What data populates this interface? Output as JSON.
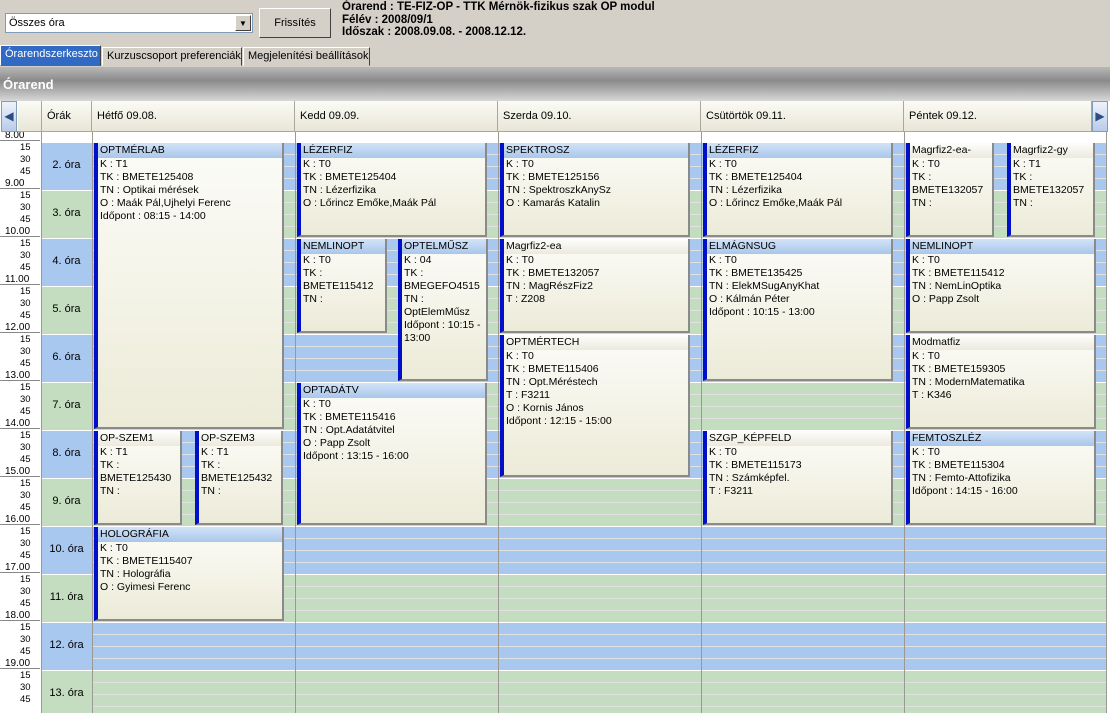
{
  "top": {
    "combo_value": "Összes óra",
    "refresh_label": "Frissítés",
    "orarend_line": "Órarend : TE-FIZ-OP - TTK Mérnök-fizikus szak OP modul",
    "felev_line": "Félév : 2008/09/1",
    "idoszak_line": "Időszak : 2008.09.08. - 2008.12.12."
  },
  "tabs": [
    "Órarendszerkeszto",
    "Kurzuscsoport preferenciák",
    "Megjelenítési beállítások"
  ],
  "panel_title": "Órarend",
  "header": {
    "prev_icon": "◀",
    "next_icon": "▶",
    "hours_label": "Órák",
    "days": [
      "Hétfő  09.08.",
      "Kedd  09.09.",
      "Szerda  09.10.",
      "Csütörtök  09.11.",
      "Péntek  09.12."
    ]
  },
  "hours": [
    "8.00",
    "9.00",
    "10.00",
    "11.00",
    "12.00",
    "13.00",
    "14.00",
    "15.00",
    "16.00",
    "17.00",
    "18.00",
    "19.00"
  ],
  "quarters": [
    "15",
    "30",
    "45"
  ],
  "periods": [
    "2. óra",
    "3. óra",
    "4. óra",
    "5. óra",
    "6. óra",
    "7. óra",
    "8. óra",
    "9. óra",
    "10. óra",
    "11. óra",
    "12. óra",
    "13. óra"
  ],
  "colors": {
    "blue_band": "#a8c8f0",
    "green_band": "#c4dcc0",
    "event_bar": "#0010c8"
  },
  "events": [
    {
      "title": "OPTMÉRLAB",
      "lines": [
        "K : T1",
        "TK : BMETE125408",
        "TN : Optikai mérések",
        "O : Maák Pál,Ujhelyi Ferenc",
        "Időpont : 08:15 - 14:00"
      ]
    },
    {
      "title": "LÉZERFIZ",
      "lines": [
        "K : T0",
        "TK : BMETE125404",
        "TN : Lézerfizika",
        "O : Lőrincz Emőke,Maák Pál"
      ]
    },
    {
      "title": "SPEKTROSZ",
      "lines": [
        "K : T0",
        "TK : BMETE125156",
        "TN : SpektroszkAnySz",
        "O : Kamarás Katalin"
      ]
    },
    {
      "title": "LÉZERFIZ",
      "lines": [
        "K : T0",
        "TK : BMETE125404",
        "TN : Lézerfizika",
        "O : Lőrincz Emőke,Maák Pál"
      ]
    },
    {
      "title": "Magrfiz2-ea-",
      "lines": [
        "K : T0",
        "TK :",
        "BMETE132057",
        "TN :"
      ]
    },
    {
      "title": "Magrfiz2-gy",
      "lines": [
        "K : T1",
        "TK :",
        "BMETE132057",
        "TN :"
      ]
    },
    {
      "title": "NEMLINOPT",
      "lines": [
        "K : T0",
        "TK :",
        "BMETE115412",
        "TN :"
      ]
    },
    {
      "title": "OPTELMŰSZ",
      "lines": [
        "K : 04",
        "TK :",
        "BMEGEFO4515",
        "TN :",
        "OptElemMűsz",
        "Időpont : 10:15 -",
        "13:00"
      ]
    },
    {
      "title": "Magrfiz2-ea",
      "lines": [
        "K : T0",
        "TK : BMETE132057",
        "TN : MagRészFiz2",
        "T : Z208"
      ]
    },
    {
      "title": "ELMÁGNSUG",
      "lines": [
        "K : T0",
        "TK : BMETE135425",
        "TN : ElekMSugAnyKhat",
        "O : Kálmán Péter",
        "Időpont : 10:15 - 13:00"
      ]
    },
    {
      "title": "NEMLINOPT",
      "lines": [
        "K : T0",
        "TK : BMETE115412",
        "TN : NemLinOptika",
        "O : Papp Zsolt"
      ]
    },
    {
      "title": "OPTMÉRTECH",
      "lines": [
        "K : T0",
        "TK : BMETE115406",
        "TN : Opt.Méréstech",
        "T : F3211",
        "O : Kornis János",
        "Időpont : 12:15 - 15:00"
      ]
    },
    {
      "title": "Modmatfiz",
      "lines": [
        "K : T0",
        "TK : BMETE159305",
        "TN : ModernMatematika",
        "T : K346"
      ]
    },
    {
      "title": "OPTADÁTV",
      "lines": [
        "K : T0",
        "TK : BMETE115416",
        "TN : Opt.Adatátvitel",
        "O : Papp Zsolt",
        "Időpont : 13:15 - 16:00"
      ]
    },
    {
      "title": "OP-SZEM1",
      "lines": [
        "K : T1",
        "TK :",
        "BMETE125430",
        "TN :"
      ]
    },
    {
      "title": "OP-SZEM3",
      "lines": [
        "K : T1",
        "TK :",
        "BMETE125432",
        "TN :"
      ]
    },
    {
      "title": "SZGP_KÉPFELD",
      "lines": [
        "K : T0",
        "TK : BMETE115173",
        "TN : Számképfel.",
        "T : F3211"
      ]
    },
    {
      "title": "FEMTOSZLÉZ",
      "lines": [
        "K : T0",
        "TK : BMETE115304",
        "TN : Femto-Attofizika",
        "Időpont : 14:15 - 16:00"
      ]
    },
    {
      "title": "HOLOGRÁFIA",
      "lines": [
        "K : T0",
        "TK : BMETE115407",
        "TN : Holográfia",
        "O : Gyimesi Ferenc"
      ]
    }
  ]
}
